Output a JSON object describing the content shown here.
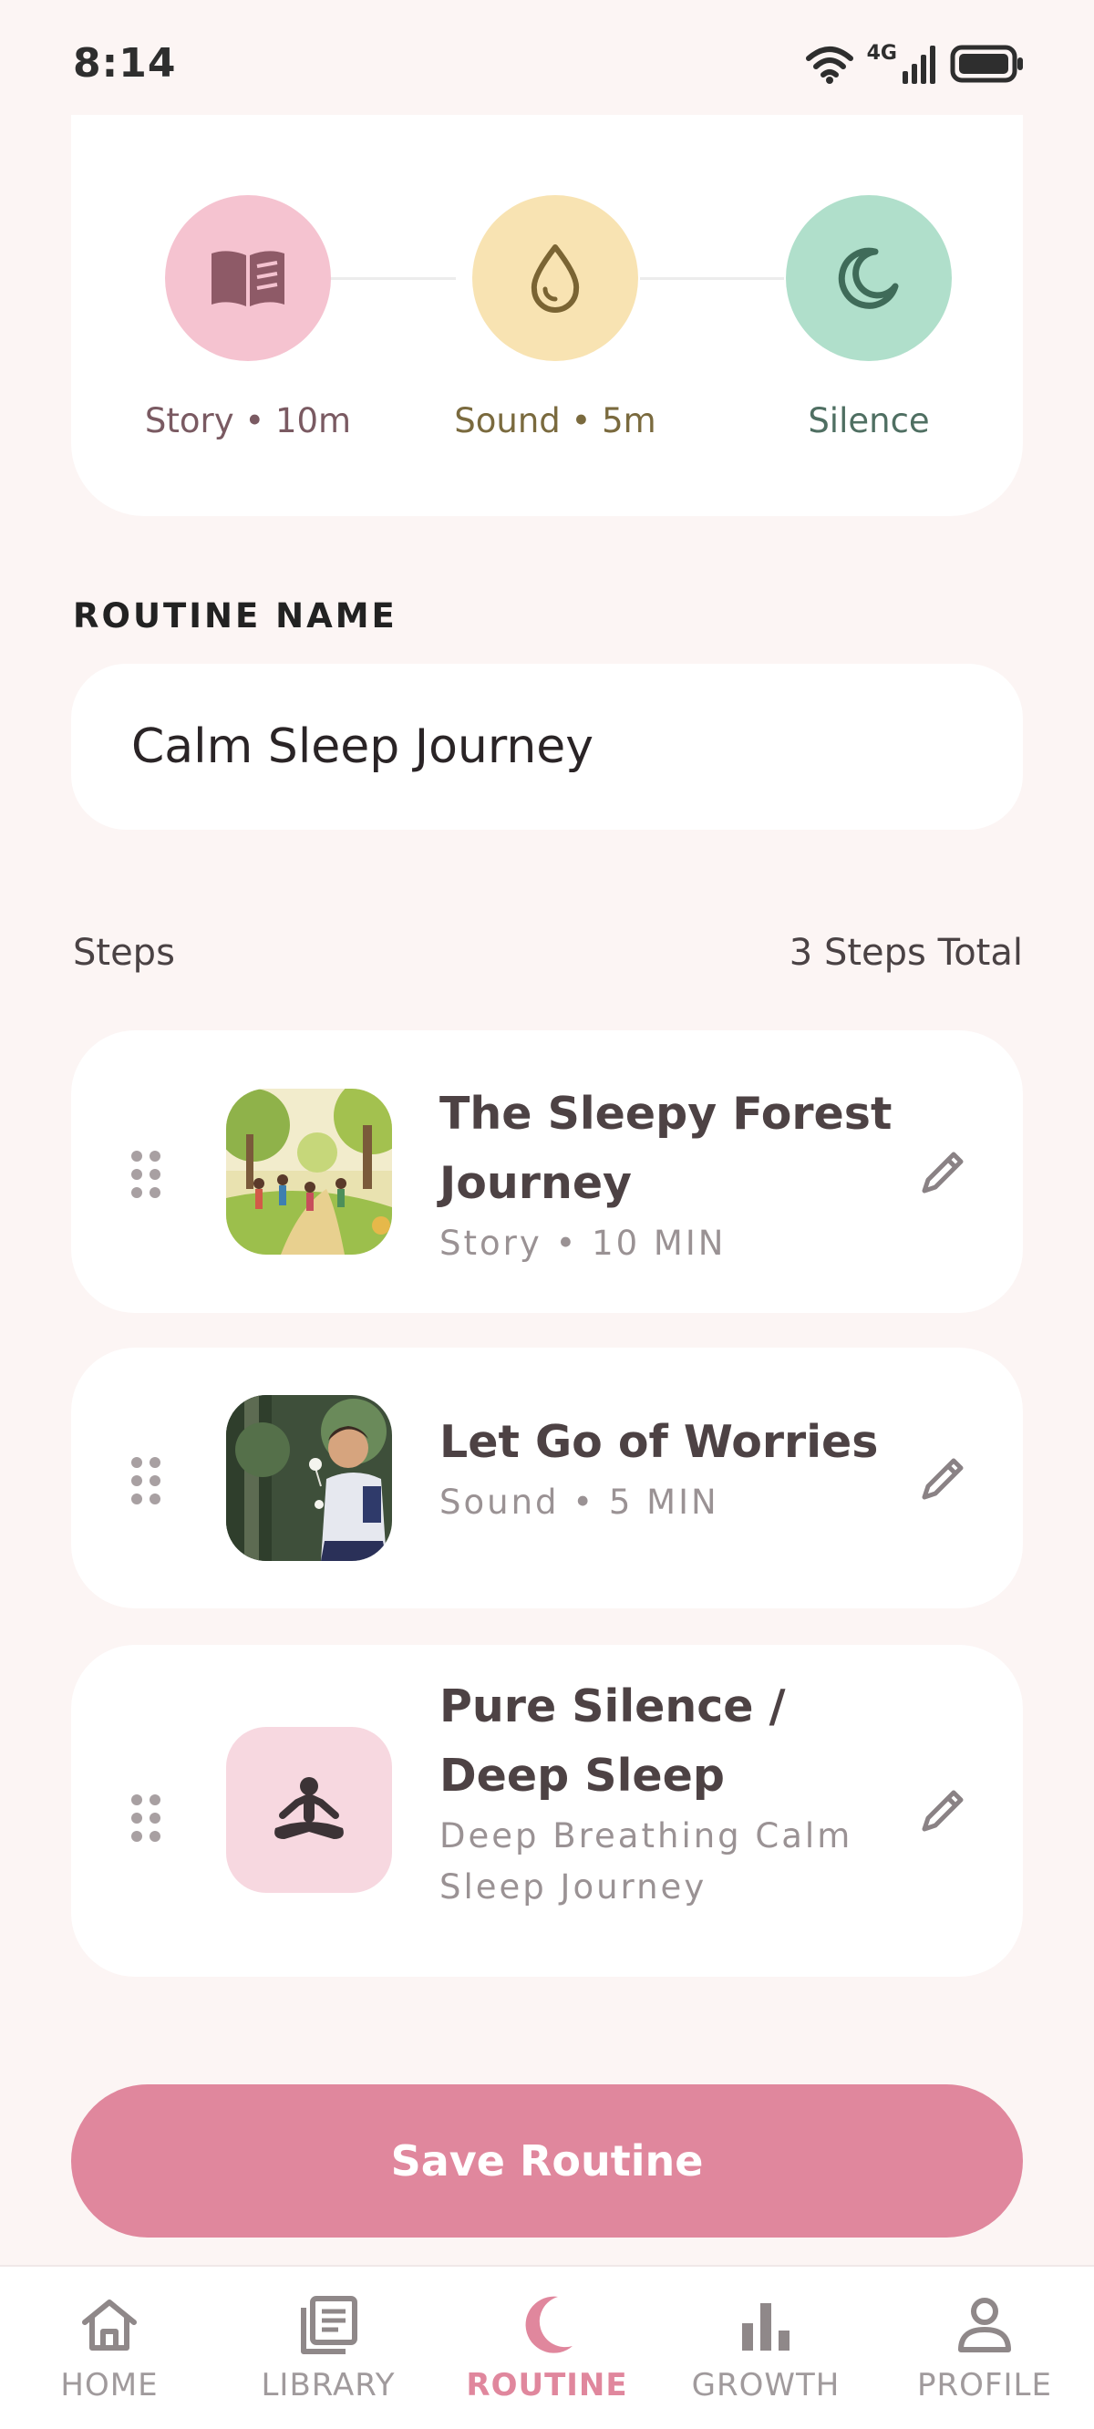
{
  "status_bar": {
    "time": "8:14",
    "network": "4G"
  },
  "progress": {
    "steps": [
      {
        "label": "Story • 10m",
        "icon": "book-icon",
        "color": "#f5c3d0",
        "text_color": "#7a5a62"
      },
      {
        "label": "Sound • 5m",
        "icon": "droplet-icon",
        "color": "#f8e3b2",
        "text_color": "#7a6a3e"
      },
      {
        "label": "Silence",
        "icon": "moon-icon",
        "color": "#b0dfcb",
        "text_color": "#4f6f62"
      }
    ]
  },
  "routine_name": {
    "label": "ROUTINE NAME",
    "value": "Calm Sleep Journey"
  },
  "steps_header": {
    "title": "Steps",
    "count": "3 Steps Total"
  },
  "steps": [
    {
      "title": "The Sleepy Forest Journey",
      "subtitle": "Story • 10 MIN"
    },
    {
      "title": "Let Go of Worries",
      "subtitle": "Sound • 5 MIN"
    },
    {
      "title": "Pure Silence / Deep Sleep",
      "subtitle": "Deep Breathing Calm Sleep Journey"
    }
  ],
  "save_button": {
    "label": "Save Routine"
  },
  "nav": {
    "items": [
      {
        "label": "HOME",
        "icon": "home-icon"
      },
      {
        "label": "LIBRARY",
        "icon": "library-icon"
      },
      {
        "label": "ROUTINE",
        "icon": "moon-icon",
        "active": true
      },
      {
        "label": "GROWTH",
        "icon": "bar-chart-icon"
      },
      {
        "label": "PROFILE",
        "icon": "person-icon"
      }
    ]
  },
  "colors": {
    "accent": "#e0879d",
    "background": "#fcf5f4",
    "card": "#ffffff"
  }
}
